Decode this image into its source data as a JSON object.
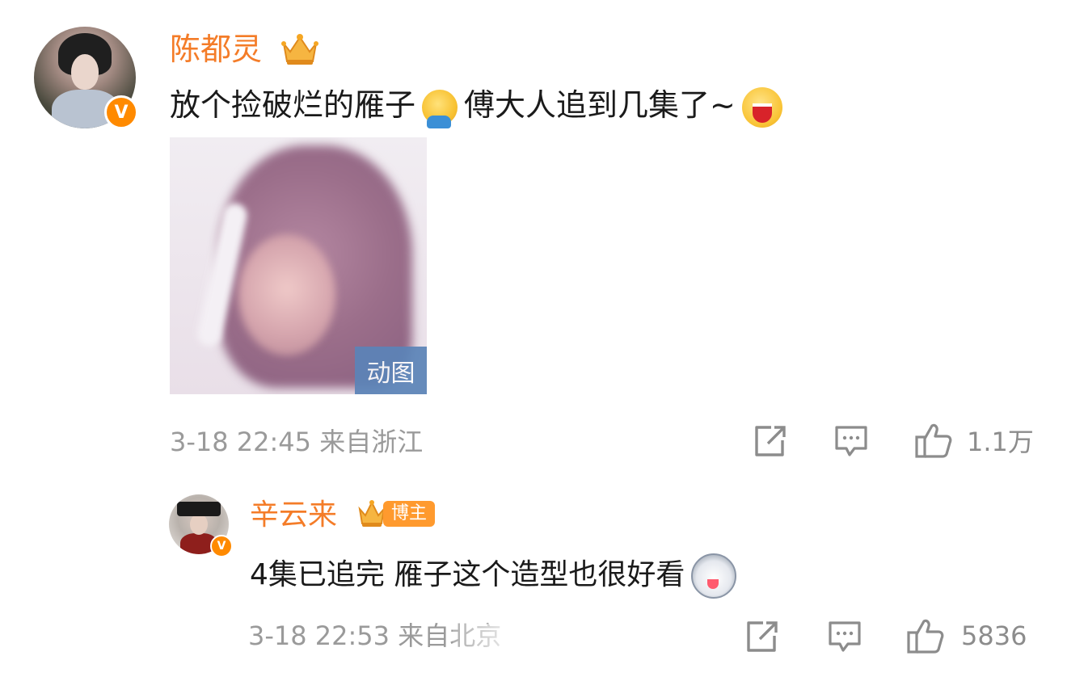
{
  "comment": {
    "author": "陈都灵",
    "text_before": "放个捡破烂的雁子",
    "emoji_1": "facepalm-emoji",
    "text_after": "傅大人追到几集了~",
    "emoji_2": "laughing-emoji",
    "media_badge": "动图",
    "date": "3-18 22:45",
    "location": "来自浙江",
    "likes": "1.1万"
  },
  "reply": {
    "author": "辛云来",
    "badge": "博主",
    "text": "4集已追完 雁子这个造型也很好看",
    "emoji": "husky-emoji",
    "date": "3-18 22:53",
    "location": "来自北京",
    "likes": "5836"
  },
  "colors": {
    "name": "#f47c28",
    "verified_badge": "#ff8a00",
    "meta": "#9a9a9a",
    "gif_badge": "#5b84b8"
  }
}
